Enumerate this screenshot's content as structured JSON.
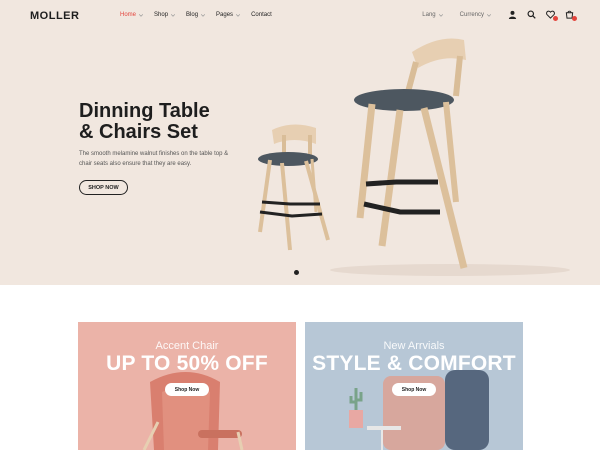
{
  "brand": {
    "logo": "MOLLER"
  },
  "nav": {
    "items": [
      {
        "label": "Home",
        "active": true,
        "has_dropdown": true
      },
      {
        "label": "Shop",
        "active": false,
        "has_dropdown": true
      },
      {
        "label": "Blog",
        "active": false,
        "has_dropdown": true
      },
      {
        "label": "Pages",
        "active": false,
        "has_dropdown": true
      },
      {
        "label": "Contact",
        "active": false,
        "has_dropdown": false
      }
    ]
  },
  "header_right": {
    "lang_label": "Lang",
    "currency_label": "Currency",
    "icons": [
      "user-icon",
      "search-icon",
      "wishlist-icon",
      "cart-icon"
    ]
  },
  "hero": {
    "title_line1": "Dinning Table",
    "title_line2": "& Chairs Set",
    "description": "The smooth melamine walnut finishes on the table top & chair seats also ensure that they are easy.",
    "button_label": "SHOP NOW",
    "slide_count": 1,
    "active_slide": 1
  },
  "banners": [
    {
      "subtitle": "Accent Chair",
      "headline": "UP TO 50% OFF",
      "button_label": "Shop Now"
    },
    {
      "subtitle": "New Arrvials",
      "headline": "STYLE & COMFORT",
      "button_label": "Shop Now"
    }
  ],
  "colors": {
    "accent": "#e3453d",
    "hero_bg": "#f1e7df",
    "banner_left_bg": "#ebb3a8",
    "banner_right_bg": "#b7c7d6",
    "text_dark": "#1e1e1e"
  }
}
